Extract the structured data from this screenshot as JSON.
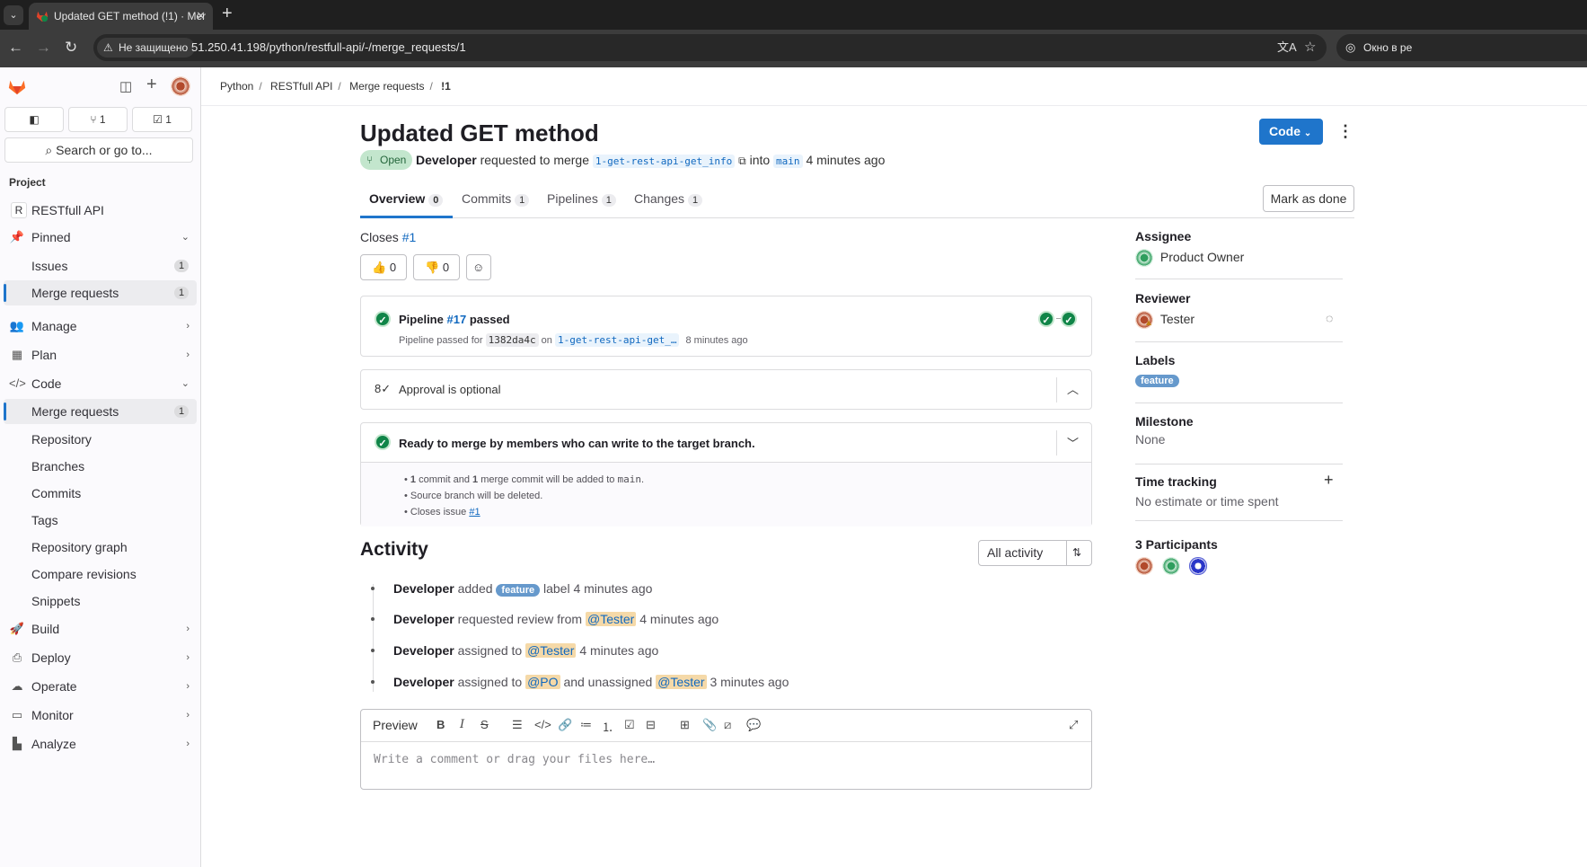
{
  "browser": {
    "tab_title": "Updated GET method (!1) · Mer",
    "url_security": "Не защищено",
    "url": "51.250.41.198/python/restfull-api/-/merge_requests/1",
    "incognito_label": "Окно в ре"
  },
  "sidebar": {
    "counts": [
      {
        "icon": "issues-icon",
        "value": ""
      },
      {
        "icon": "merge-request-icon",
        "value": "1"
      },
      {
        "icon": "todo-icon",
        "value": "1"
      }
    ],
    "search_placeholder": "Search or go to...",
    "section_label": "Project",
    "project_initial": "R",
    "project_name": "RESTfull API",
    "items": {
      "pinned": "Pinned",
      "issues": "Issues",
      "issues_count": "1",
      "mr_pinned": "Merge requests",
      "mr_pinned_count": "1",
      "manage": "Manage",
      "plan": "Plan",
      "code": "Code",
      "mr_code": "Merge requests",
      "mr_code_count": "1",
      "repository": "Repository",
      "branches": "Branches",
      "commits": "Commits",
      "tags": "Tags",
      "repo_graph": "Repository graph",
      "compare": "Compare revisions",
      "snippets": "Snippets",
      "build": "Build",
      "deploy": "Deploy",
      "operate": "Operate",
      "monitor": "Monitor",
      "analyze": "Analyze"
    }
  },
  "breadcrumb": [
    "Python",
    "RESTfull API",
    "Merge requests",
    "!1"
  ],
  "mr": {
    "title": "Updated GET method",
    "code_button": "Code",
    "status": "Open",
    "author": "Developer",
    "requested_text": "requested to merge",
    "source_branch": "1-get-rest-api-get_info",
    "into_text": "into",
    "target_branch": "main",
    "time": "4 minutes ago"
  },
  "tabs": [
    {
      "label": "Overview",
      "count": "0"
    },
    {
      "label": "Commits",
      "count": "1"
    },
    {
      "label": "Pipelines",
      "count": "1"
    },
    {
      "label": "Changes",
      "count": "1"
    }
  ],
  "mark_done": "Mark as done",
  "closes": {
    "prefix": "Closes",
    "issue": "#1"
  },
  "reactions": {
    "thumbs_up": "0",
    "thumbs_down": "0"
  },
  "pipeline": {
    "prefix": "Pipeline",
    "id": "#17",
    "status": "passed",
    "sub_prefix": "Pipeline passed for",
    "commit": "1382da4c",
    "on": "on",
    "branch": "1-get-rest-api-get_…",
    "time": "8 minutes ago"
  },
  "approval": {
    "text": "Approval is optional"
  },
  "ready": {
    "title": "Ready to merge by members who can write to the target branch.",
    "bullets": {
      "b1_a": "1",
      "b1_b": "commit and",
      "b1_c": "1",
      "b1_d": "merge commit will be added to",
      "b1_branch": "main",
      "b1_end": ".",
      "b2": "Source branch will be deleted.",
      "b3_prefix": "Closes issue",
      "b3_link": "#1"
    }
  },
  "activity": {
    "title": "Activity",
    "filter": "All activity",
    "items": [
      {
        "actor": "Developer",
        "a": "added",
        "label": "feature",
        "b": "label 4 minutes ago"
      },
      {
        "actor": "Developer",
        "a": "requested review from",
        "mention": "@Tester",
        "b": "4 minutes ago"
      },
      {
        "actor": "Developer",
        "a": "assigned to",
        "mention": "@Tester",
        "b": "4 minutes ago"
      },
      {
        "actor": "Developer",
        "a": "assigned to",
        "mention": "@PO",
        "c": "and unassigned",
        "mention2": "@Tester",
        "b": "3 minutes ago"
      }
    ]
  },
  "editor": {
    "preview": "Preview",
    "placeholder": "Write a comment or drag your files here…"
  },
  "right": {
    "assignee_title": "Assignee",
    "assignee": "Product Owner",
    "reviewer_title": "Reviewer",
    "reviewer": "Tester",
    "labels_title": "Labels",
    "label": "feature",
    "milestone_title": "Milestone",
    "milestone": "None",
    "time_title": "Time tracking",
    "time_value": "No estimate or time spent",
    "participants_title": "3 Participants"
  },
  "colors": {
    "primary": "#1f75cb",
    "success": "#108548",
    "label_feature": "#6699cc"
  }
}
